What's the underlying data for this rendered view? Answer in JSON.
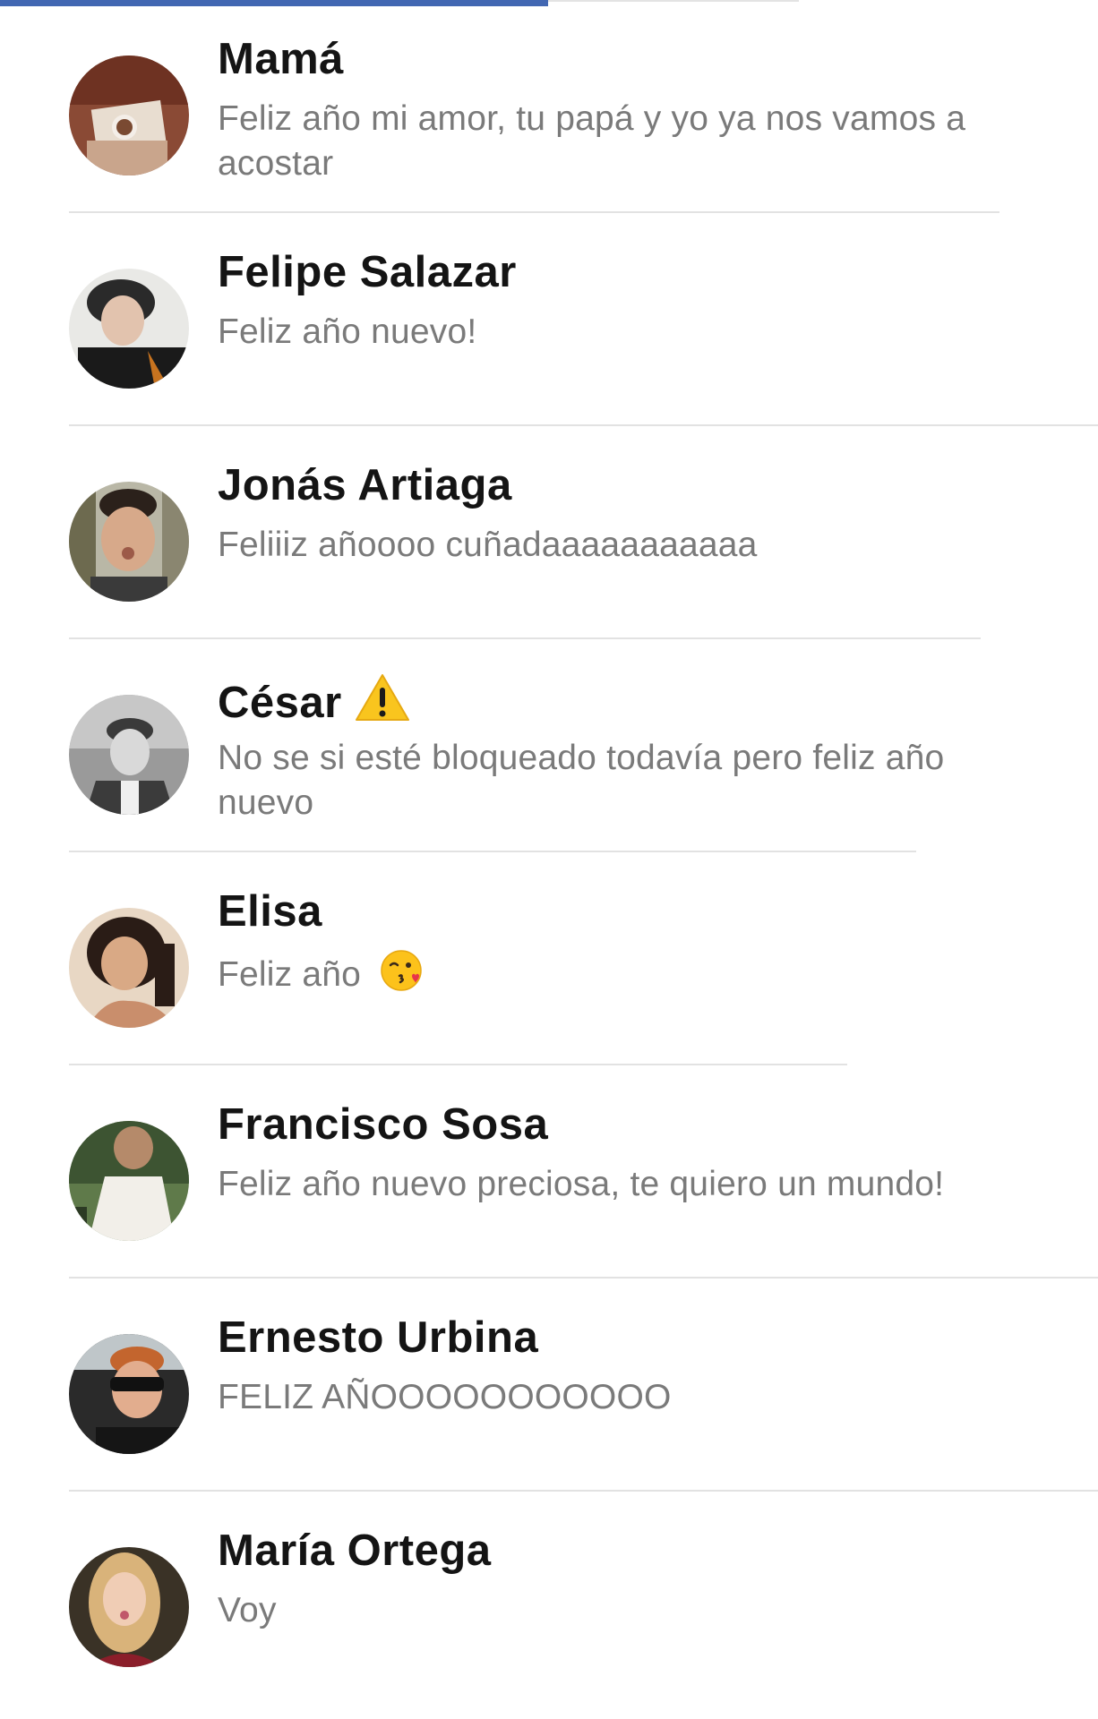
{
  "conversations": [
    {
      "name": "Mamá",
      "preview": "Feliz año mi amor, tu papá y yo ya nos vamos a acostar",
      "avatar_icon": "avatar-photo"
    },
    {
      "name": "Felipe Salazar",
      "preview": "Feliz año nuevo!",
      "avatar_icon": "avatar-photo"
    },
    {
      "name": "Jonás Artiaga",
      "preview": "Feliiiz añoooo cuñadaaaaaaaaaaa",
      "avatar_icon": "avatar-photo"
    },
    {
      "name": "César",
      "preview": "No se si esté bloqueado todavía pero feliz año nuevo",
      "badge_icon": "warning-icon",
      "avatar_icon": "avatar-photo"
    },
    {
      "name": "Elisa",
      "preview": "Feliz año",
      "preview_icon": "kissing-face-emoji",
      "avatar_icon": "avatar-photo"
    },
    {
      "name": "Francisco Sosa",
      "preview": "Feliz año nuevo preciosa, te quiero un mundo!",
      "avatar_icon": "avatar-photo"
    },
    {
      "name": "Ernesto Urbina",
      "preview": "FELIZ AÑOOOOOOOOOOO",
      "avatar_icon": "avatar-photo"
    },
    {
      "name": "María Ortega",
      "preview": "Voy",
      "avatar_icon": "avatar-photo"
    }
  ],
  "colors": {
    "accent": "#4267b2",
    "name_text": "#141414",
    "preview_text": "#7a7a7a",
    "divider": "#e2e2e2"
  }
}
